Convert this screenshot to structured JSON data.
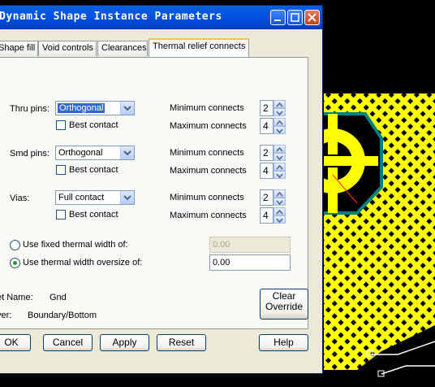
{
  "window": {
    "title": "Dynamic Shape Instance Parameters"
  },
  "tabs": [
    "Shape fill",
    "Void controls",
    "Clearances",
    "Thermal relief connects"
  ],
  "rows": [
    {
      "label": "Thru pins:",
      "value": "Orthogonal",
      "best_contact": "Best contact",
      "min_label": "Minimum connects",
      "min": "2",
      "max_label": "Maximum connects",
      "max": "4"
    },
    {
      "label": "Smd pins:",
      "value": "Orthogonal",
      "best_contact": "Best contact",
      "min_label": "Minimum connects",
      "min": "2",
      "max_label": "Maximum connects",
      "max": "4"
    },
    {
      "label": "Vias:",
      "value": "Full contact",
      "best_contact": "Best contact",
      "min_label": "Minimum connects",
      "min": "2",
      "max_label": "Maximum connects",
      "max": "4"
    }
  ],
  "thermal": {
    "fixed_label": "Use fixed thermal width of:",
    "fixed_value": "0.00",
    "oversize_label": "Use thermal width oversize of:",
    "oversize_value": "0.00"
  },
  "info": {
    "net_label": "et Name:",
    "net_value": "Gnd",
    "layer_label": "yer:",
    "layer_value": "Boundary/Bottom"
  },
  "buttons": {
    "clear_line1": "Clear",
    "clear_line2": "Override",
    "ok": "OK",
    "cancel": "Cancel",
    "apply": "Apply",
    "reset": "Reset",
    "help": "Help"
  },
  "colors": {
    "title_bar": "#0054e3",
    "pcb_copper": "#ffff00",
    "pcb_bg": "#000000",
    "pad_outline": "#008080"
  }
}
